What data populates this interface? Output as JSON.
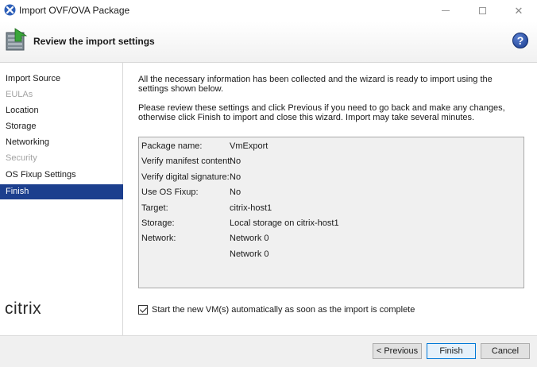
{
  "window": {
    "title": "Import OVF/OVA Package",
    "minimize_glyph": "—",
    "maximize_glyph": "☐",
    "close_glyph": "✕"
  },
  "header": {
    "title": "Review the import settings",
    "help_label": "?"
  },
  "sidebar": {
    "items": [
      {
        "label": "Import Source",
        "state": "normal"
      },
      {
        "label": "EULAs",
        "state": "disabled"
      },
      {
        "label": "Location",
        "state": "normal"
      },
      {
        "label": "Storage",
        "state": "normal"
      },
      {
        "label": "Networking",
        "state": "normal"
      },
      {
        "label": "Security",
        "state": "disabled"
      },
      {
        "label": "OS Fixup Settings",
        "state": "normal"
      },
      {
        "label": "Finish",
        "state": "active"
      }
    ],
    "brand": "citrix"
  },
  "main": {
    "intro": "All the necessary information has been collected and the wizard is ready to import using the settings shown below.",
    "review": "Please review these settings and click Previous if you need to go back and make any changes, otherwise click Finish to import and close this wizard. Import may take several minutes.",
    "settings": [
      {
        "label": "Package name:",
        "value": "VmExport"
      },
      {
        "label": "Verify manifest content:",
        "value": "No"
      },
      {
        "label": "Verify digital signature:",
        "value": "No"
      },
      {
        "label": "Use OS Fixup:",
        "value": "No"
      },
      {
        "label": "Target:",
        "value": "citrix-host1"
      },
      {
        "label": "Storage:",
        "value": "Local storage on citrix-host1"
      },
      {
        "label": "Network:",
        "value": "Network 0"
      },
      {
        "label": "",
        "value": "Network 0"
      }
    ],
    "auto_start": {
      "label": "Start the new VM(s) automatically as soon as the import is complete",
      "checked": true
    }
  },
  "footer": {
    "previous_label": "< Previous",
    "finish_label": "Finish",
    "cancel_label": "Cancel"
  },
  "colors": {
    "selection": "#1c3f8e",
    "disabled_text": "#a3a3a3",
    "panel_bg": "#f0f0f0"
  }
}
